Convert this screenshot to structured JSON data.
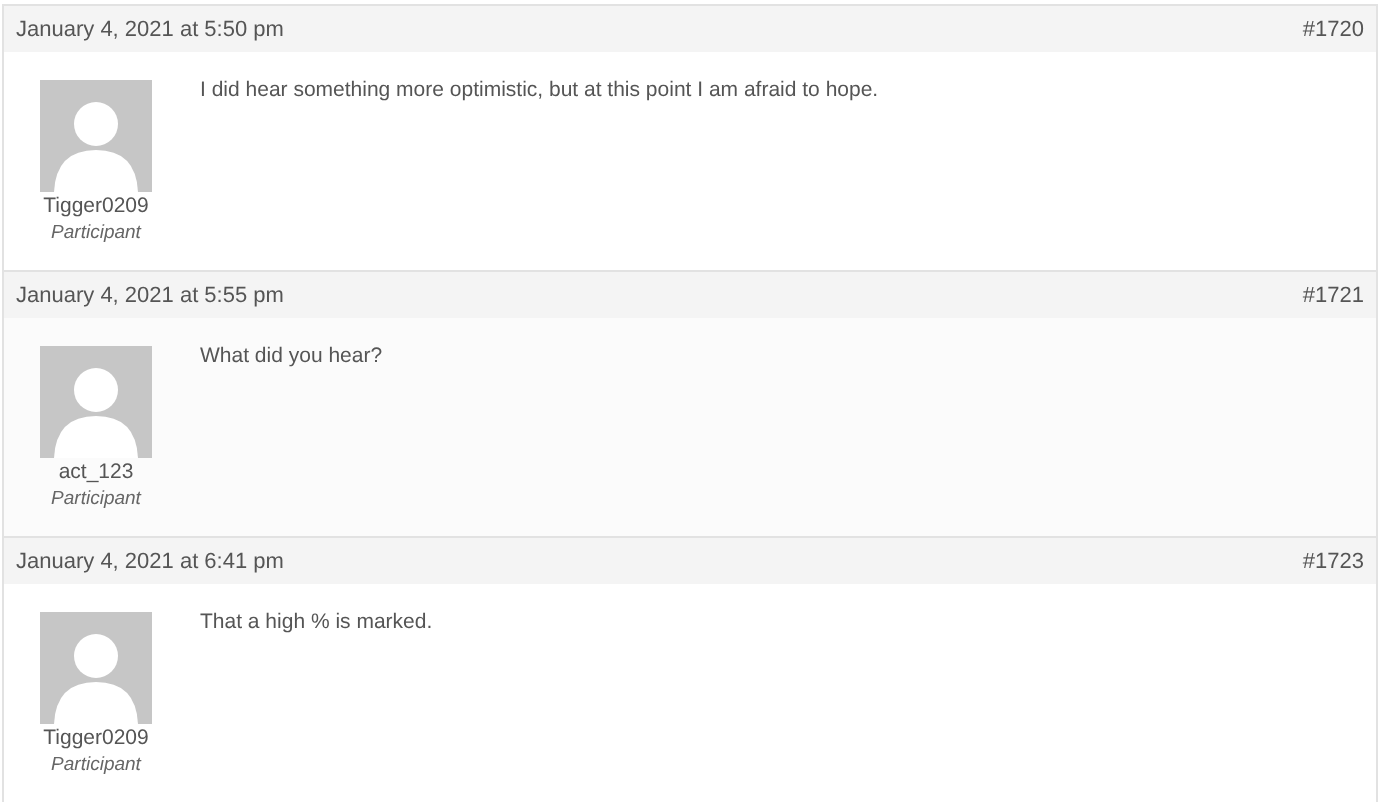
{
  "replies": [
    {
      "date": "January 4, 2021 at 5:50 pm",
      "permalink": "#1720",
      "author": "Tigger0209",
      "role": "Participant",
      "content": "I did hear something more optimistic, but at this point I am afraid to hope."
    },
    {
      "date": "January 4, 2021 at 5:55 pm",
      "permalink": "#1721",
      "author": "act_123",
      "role": "Participant",
      "content": "What did you hear?"
    },
    {
      "date": "January 4, 2021 at 6:41 pm",
      "permalink": "#1723",
      "author": "Tigger0209",
      "role": "Participant",
      "content": "That a high % is marked."
    }
  ]
}
